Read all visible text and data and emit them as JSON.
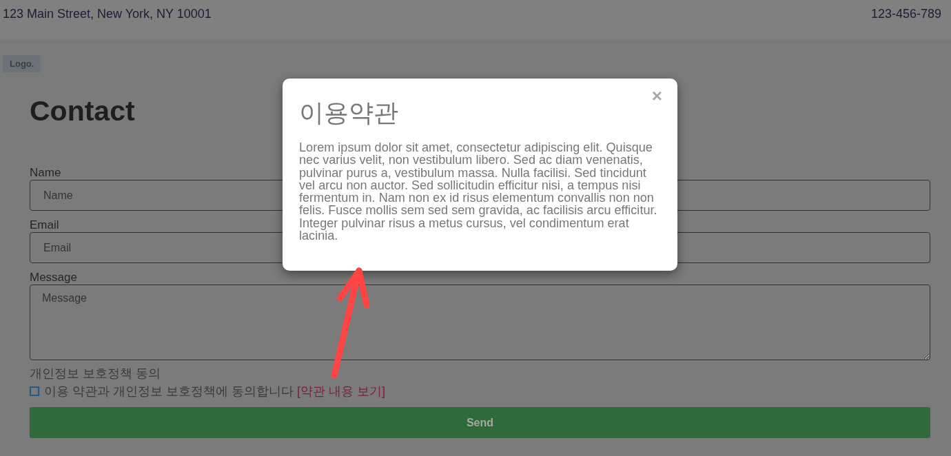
{
  "top_bar": {
    "address": "123 Main Street, New York, NY 10001",
    "phone": "123-456-789"
  },
  "logo": "Logo.",
  "page_title": "Contact",
  "form": {
    "fields": [
      {
        "kind": "input",
        "label": "Name",
        "placeholder": "Name"
      },
      {
        "kind": "input",
        "label": "Email",
        "placeholder": "Email"
      },
      {
        "kind": "textarea",
        "label": "Message",
        "placeholder": "Message"
      }
    ],
    "consent": {
      "heading": "개인정보 보호정책 동의",
      "checked": false,
      "text": "이용 약관과 개인정보 보호정책에 동의합니다",
      "link": "[약관 내용 보기]"
    },
    "submit": "Send"
  },
  "modal": {
    "close": "×",
    "title": "이용약관",
    "body": "Lorem ipsum dolor sit amet, consectetur adipiscing elit. Quisque nec varius velit, non vestibulum libero. Sed ac diam venenatis, pulvinar purus a, vestibulum massa. Nulla facilisi. Sed tincidunt vel arcu non auctor. Sed sollicitudin efficitur nisi, a tempus nisi fermentum in. Nam non ex id risus elementum convallis non non felis. Fusce mollis sem sed sem gravida, ac facilisis arcu efficitur. Integer pulvinar risus a metus cursus, vel condimentum erat lacinia."
  }
}
